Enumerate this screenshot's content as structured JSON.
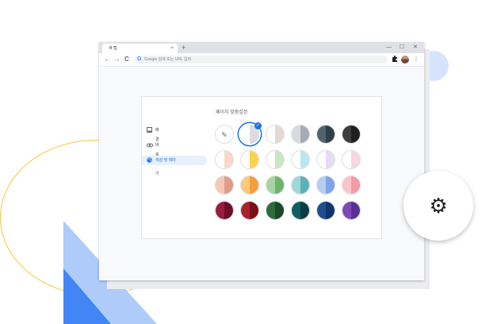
{
  "browser": {
    "tab_title": "새 탭",
    "tab_close": "×",
    "new_tab": "+",
    "window_controls": [
      "—",
      "☐",
      "✕"
    ],
    "nav": {
      "back": "←",
      "forward": "→",
      "reload": "C"
    },
    "omnibox": {
      "g_logo": "G",
      "placeholder": "Google 검색 또는 URL 입력"
    },
    "extensions_icon": "puzzle-icon",
    "menu_icon": "⋮"
  },
  "dialog": {
    "title": "페이지 맞춤설정",
    "sidebar": [
      {
        "icon": "image-icon",
        "label": "배경",
        "active": false
      },
      {
        "icon": "link-icon",
        "label": "바로가기",
        "active": false
      },
      {
        "icon": "palette-icon",
        "label": "색상 및 테마",
        "active": true
      }
    ],
    "swatches": [
      [
        {
          "l": "#ffffff",
          "r": "#ffffff",
          "picker": true
        },
        {
          "l": "#ffffff",
          "r": "#dadce0",
          "selected": true
        },
        {
          "l": "#ffffff",
          "r": "#e6d9d3"
        },
        {
          "l": "#d8dae0",
          "r": "#a7aab7"
        },
        {
          "l": "#52636a",
          "r": "#2f3f47"
        },
        {
          "l": "#3c3c3c",
          "r": "#1f1f1f"
        }
      ],
      [
        {
          "l": "#ffffff",
          "r": "#fbd7c7"
        },
        {
          "l": "#ffffff",
          "r": "#fcd34d"
        },
        {
          "l": "#ffffff",
          "r": "#c9e5c5"
        },
        {
          "l": "#ffffff",
          "r": "#b9e7ee"
        },
        {
          "l": "#ffffff",
          "r": "#e6daf7"
        },
        {
          "l": "#ffffff",
          "r": "#f7d6de"
        }
      ],
      [
        {
          "l": "#f3c9b3",
          "r": "#dc9e89"
        },
        {
          "l": "#fbc97e",
          "r": "#f59e3c"
        },
        {
          "l": "#a6d5a3",
          "r": "#6fb36e"
        },
        {
          "l": "#9ed6d9",
          "r": "#5ab2b7"
        },
        {
          "l": "#b8ccf1",
          "r": "#7ea3e7"
        },
        {
          "l": "#fbc4ca",
          "r": "#f29aa5"
        }
      ],
      [
        {
          "l": "#9b1b3f",
          "r": "#6d0f2a"
        },
        {
          "l": "#a8212b",
          "r": "#7a1018"
        },
        {
          "l": "#2e6b3a",
          "r": "#1a4925"
        },
        {
          "l": "#0f5f60",
          "r": "#0b3f41"
        },
        {
          "l": "#1d4f91",
          "r": "#0e3570"
        },
        {
          "l": "#7d4ab5",
          "r": "#5a2f93"
        }
      ]
    ],
    "check_mark": "✓",
    "picker_glyph": "✎"
  },
  "settings_fab": {
    "icon": "gear-icon",
    "glyph": "⚙"
  },
  "colors": {
    "accent": "#1a73e8",
    "ring": "#f4c842",
    "triangle_light": "#aecbfa",
    "triangle_dark": "#4285f4"
  }
}
